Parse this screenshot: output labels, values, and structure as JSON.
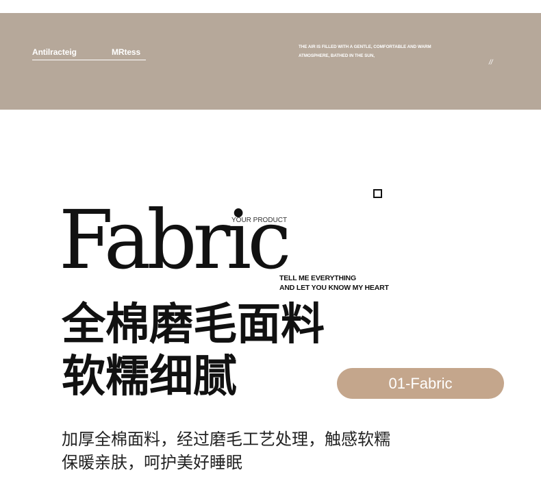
{
  "banner": {
    "nav_item_1": "Antilracteig",
    "nav_item_2": "MRtess",
    "tagline_line_1": "THE AIR IS FILLED WITH A GENTLE, COMFORTABLE AND WARM",
    "tagline_line_2": "ATMOSPHERE, BATHED IN THE SUN,",
    "slashes": "//"
  },
  "hero": {
    "title": "Fabric",
    "kicker": "YOUR PRODUCT",
    "tell_line_1": "TELL ME EVERYTHING",
    "tell_line_2": "AND LET YOU KNOW MY HEART"
  },
  "headline": {
    "line_1": "全棉磨毛面料",
    "line_2": "软糯细腻"
  },
  "badge": {
    "label": "01-Fabric"
  },
  "description": {
    "line_1": "加厚全棉面料，经过磨毛工艺处理，触感软糯",
    "line_2": "保暖亲肤，呵护美好睡眠"
  },
  "colors": {
    "banner": "#b6a89a",
    "badge": "#c4a68c",
    "text": "#111111"
  }
}
